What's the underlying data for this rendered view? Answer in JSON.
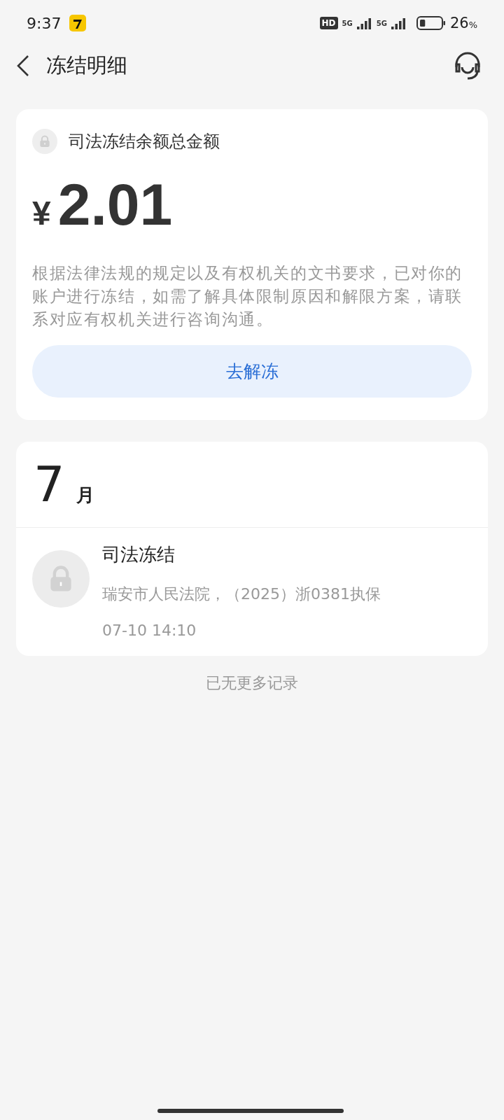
{
  "status_bar": {
    "time": "9:37",
    "hd": "HD",
    "battery": "26",
    "battery_unit": "%",
    "network_1": "5G",
    "network_2": "5G"
  },
  "header": {
    "title": "冻结明细"
  },
  "summary": {
    "label": "司法冻结余额总金额",
    "currency": "¥",
    "amount": "2.01",
    "description": "根据法律法规的规定以及有权机关的文书要求，已对你的账户进行冻结，如需了解具体限制原因和解限方案，请联系对应有权机关进行咨询沟通。",
    "button": "去解冻"
  },
  "groups": [
    {
      "month_number": "7",
      "month_unit": "月",
      "records": [
        {
          "title": "司法冻结",
          "detail": "瑞安市人民法院，（2025）浙0381执保",
          "time": "07-10 14:10"
        }
      ]
    }
  ],
  "footer": "已无更多记录"
}
